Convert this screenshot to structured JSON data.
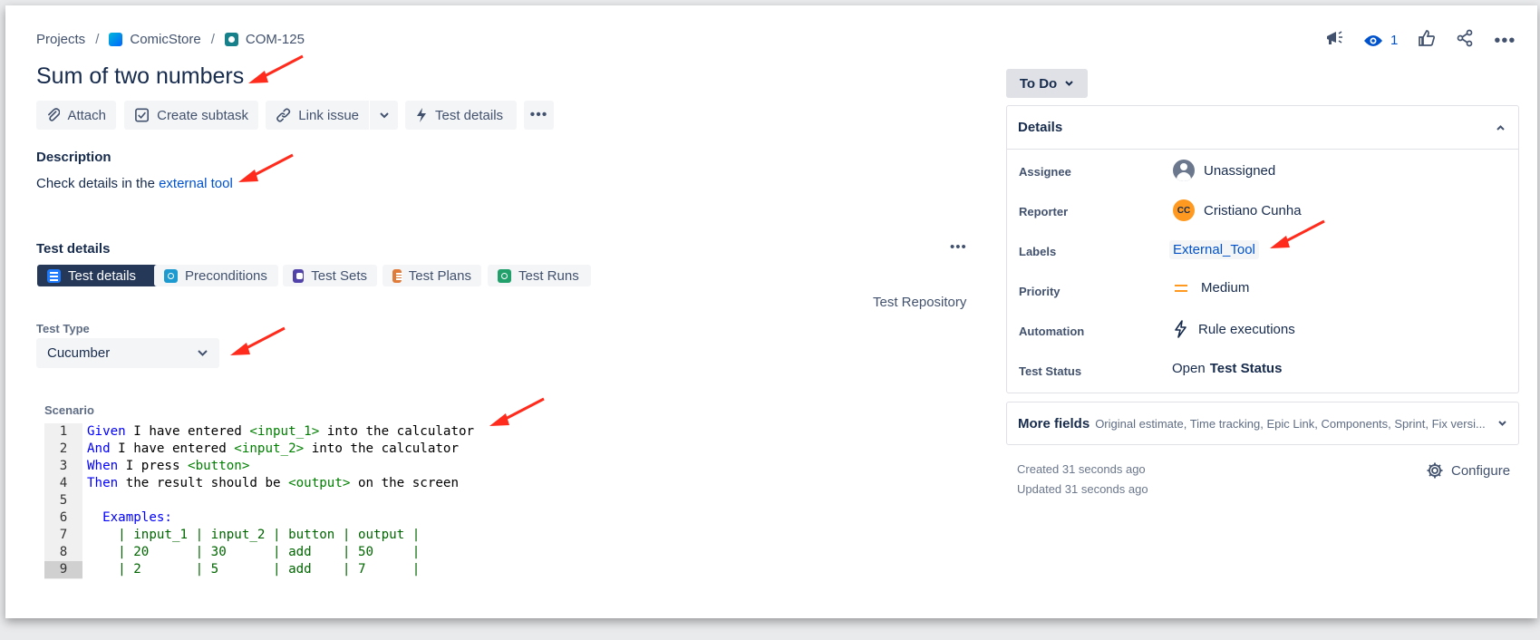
{
  "breadcrumb": {
    "projects": "Projects",
    "project": "ComicStore",
    "issue_key": "COM-125"
  },
  "header_actions": {
    "watchers_count": "1"
  },
  "issue": {
    "title": "Sum of two numbers"
  },
  "toolbar": {
    "attach": "Attach",
    "create_subtask": "Create subtask",
    "link_issue": "Link issue",
    "test_details": "Test details"
  },
  "description": {
    "heading": "Description",
    "text_prefix": "Check details in the ",
    "link_text": "external tool"
  },
  "test_details": {
    "heading": "Test details",
    "tabs": [
      {
        "label": "Test details",
        "icon": "list-icon",
        "color": "#1d7afc"
      },
      {
        "label": "Preconditions",
        "icon": "preconditions-icon",
        "color": "#1d9bd1"
      },
      {
        "label": "Test Sets",
        "icon": "test-sets-icon",
        "color": "#5243aa"
      },
      {
        "label": "Test Plans",
        "icon": "test-plans-icon",
        "color": "#e07b39"
      },
      {
        "label": "Test Runs",
        "icon": "test-runs-icon",
        "color": "#22a06b"
      }
    ],
    "repository_link": "Test Repository",
    "test_type_label": "Test Type",
    "test_type_value": "Cucumber",
    "scenario_label": "Scenario"
  },
  "scenario": {
    "line_numbers": [
      "1",
      "2",
      "3",
      "4",
      "5",
      "6",
      "7",
      "8",
      "9"
    ],
    "current_line": 9,
    "lines": [
      [
        {
          "t": "Given",
          "c": "kw"
        },
        {
          "t": " I have entered ",
          "c": ""
        },
        {
          "t": "<input_1>",
          "c": "var"
        },
        {
          "t": " into the calculator",
          "c": ""
        }
      ],
      [
        {
          "t": "And",
          "c": "kw"
        },
        {
          "t": " I have entered ",
          "c": ""
        },
        {
          "t": "<input_2>",
          "c": "var"
        },
        {
          "t": " into the calculator",
          "c": ""
        }
      ],
      [
        {
          "t": "When",
          "c": "kw"
        },
        {
          "t": " I press ",
          "c": ""
        },
        {
          "t": "<button>",
          "c": "var"
        }
      ],
      [
        {
          "t": "Then",
          "c": "kw"
        },
        {
          "t": " the result should be ",
          "c": ""
        },
        {
          "t": "<output>",
          "c": "var"
        },
        {
          "t": " on the screen",
          "c": ""
        }
      ],
      [],
      [
        {
          "t": "  Examples:",
          "c": "kw"
        }
      ],
      [
        {
          "t": "    | input_1 | input_2 | button | output |",
          "c": "tbl"
        }
      ],
      [
        {
          "t": "    | 20      | 30      | add    | 50     |",
          "c": "tbl"
        }
      ],
      [
        {
          "t": "    | 2       | 5       | add    | 7      |",
          "c": "tbl"
        }
      ]
    ]
  },
  "status": {
    "label": "To Do"
  },
  "details_panel": {
    "heading": "Details",
    "fields": {
      "assignee_label": "Assignee",
      "assignee_value": "Unassigned",
      "reporter_label": "Reporter",
      "reporter_initials": "CC",
      "reporter_value": "Cristiano Cunha",
      "labels_label": "Labels",
      "labels_value": "External_Tool",
      "priority_label": "Priority",
      "priority_value": "Medium",
      "automation_label": "Automation",
      "automation_value": "Rule executions",
      "test_status_label": "Test Status",
      "test_status_prefix": "Open",
      "test_status_value": "Test Status"
    }
  },
  "more_fields": {
    "heading": "More fields",
    "summary": "Original estimate, Time tracking, Epic Link, Components, Sprint, Fix versi..."
  },
  "meta": {
    "created": "Created 31 seconds ago",
    "updated": "Updated 31 seconds ago",
    "configure": "Configure"
  },
  "colors": {
    "accent": "#0052cc",
    "arrow": "#ff2b1c",
    "reporter_avatar": "#ff991f",
    "priority_medium": "#ff991f"
  }
}
